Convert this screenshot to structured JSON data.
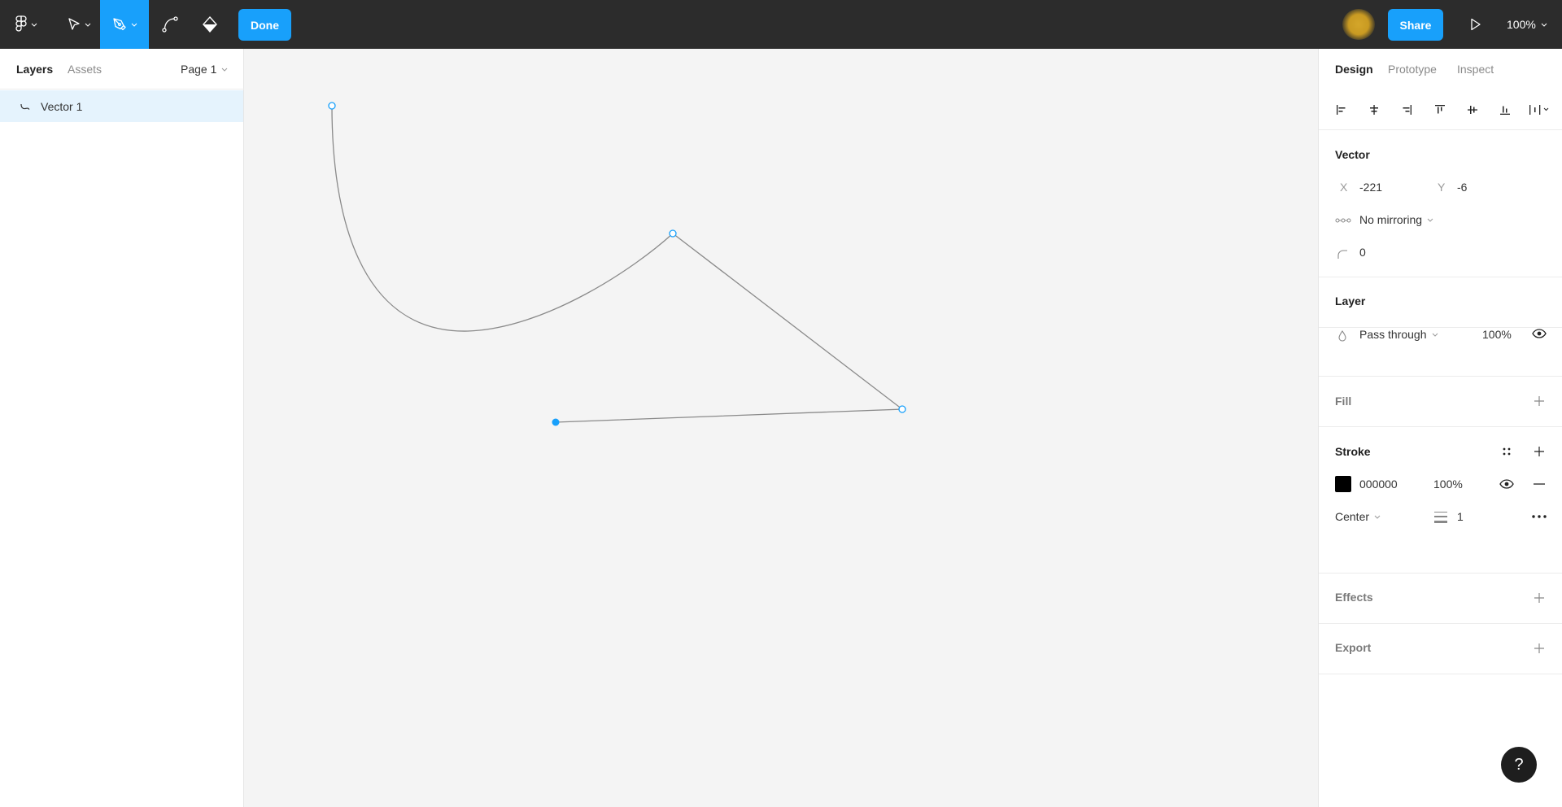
{
  "toolbar": {
    "done_label": "Done",
    "share_label": "Share",
    "zoom_level": "100%",
    "active_tool": "pen",
    "accent_color": "#18a0fb",
    "avatar_color": "#d4a62a"
  },
  "left_panel": {
    "tabs": [
      {
        "label": "Layers",
        "active": true
      },
      {
        "label": "Assets",
        "active": false
      }
    ],
    "page_select": "Page 1",
    "layers": [
      {
        "name": "Vector 1",
        "icon": "vector-icon",
        "selected": true
      }
    ]
  },
  "right_panel": {
    "tabs": [
      {
        "label": "Design",
        "active": true
      },
      {
        "label": "Prototype",
        "active": false
      },
      {
        "label": "Inspect",
        "active": false
      }
    ],
    "vector": {
      "title": "Vector",
      "x_label": "X",
      "x_value": "-221",
      "y_label": "Y",
      "y_value": "-6",
      "mirroring": "No mirroring",
      "corner_radius": "0"
    },
    "layer": {
      "title": "Layer",
      "blend_mode": "Pass through",
      "opacity": "100%"
    },
    "fill": {
      "title": "Fill"
    },
    "stroke": {
      "title": "Stroke",
      "color_hex": "000000",
      "color": "#000000",
      "opacity": "100%",
      "position": "Center",
      "weight": "1"
    },
    "effects": {
      "title": "Effects"
    },
    "export": {
      "title": "Export"
    }
  },
  "help": {
    "label": "?"
  }
}
